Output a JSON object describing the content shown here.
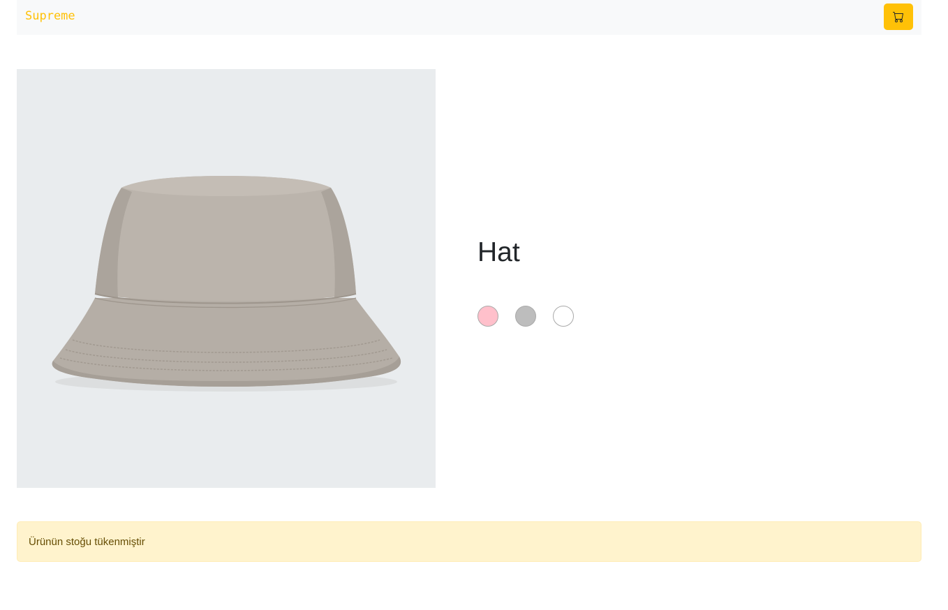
{
  "navbar": {
    "brand": "Supreme",
    "cart_icon": "cart-icon"
  },
  "product": {
    "title": "Hat",
    "image_icon": "bucket-hat-image",
    "colors": [
      {
        "name": "pink",
        "hex": "#ffc0cb"
      },
      {
        "name": "gray",
        "hex": "#bdbdbd"
      },
      {
        "name": "white",
        "hex": "#ffffff"
      }
    ]
  },
  "alert": {
    "message": "Ürünün stoğu tükenmiştir"
  },
  "theme": {
    "accent": "#ffc107",
    "navbar_bg": "#f8f9fa",
    "alert_bg": "#fff3cd",
    "alert_text": "#664d03"
  }
}
